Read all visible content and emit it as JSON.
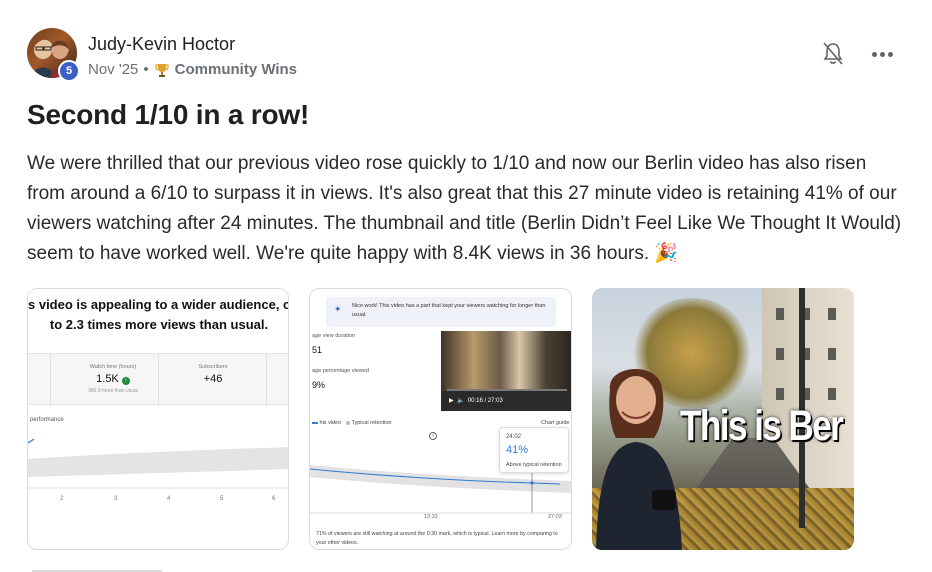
{
  "post": {
    "author": "Judy-Kevin Hoctor",
    "level": "5",
    "date": "Nov '25",
    "separator": "•",
    "category": "Community Wins",
    "title": "Second 1/10 in a row!",
    "body": "We were thrilled that our previous video rose quickly to 1/10 and now our Berlin video has also risen from around a 6/10 to surpass it in views. It's also great that this 27 minute video is retaining 41% of our viewers watching after 24 minutes. The thumbnail and title (Berlin Didn’t Feel Like We Thought It Would) seem to have worked well. We're quite happy with 8.4K views in 36 hours. 🎉"
  },
  "icons": {
    "trophy": "trophy-icon",
    "bell": "bell-off-icon",
    "more": "more-horizontal-icon"
  },
  "colors": {
    "badge": "#3b5fc4",
    "accent_blue": "#2f7dd1"
  },
  "images": [
    {
      "headline_1": "s video is appealing to a wider audience, con",
      "headline_2": "to 2.3 times more views than usual.",
      "stats": [
        {
          "label": "Watch time (hours)",
          "value": "1.5K",
          "sub": "980.9 more than usual"
        },
        {
          "label": "Subscribers",
          "value": "+46",
          "sub": ""
        }
      ],
      "perf_label": "performance",
      "axis": [
        "2",
        "3",
        "4",
        "5",
        "6"
      ]
    },
    {
      "tip": "Nice work! This video has a part that kept your viewers watching for longer than usual.",
      "avd_label": "age view duration",
      "avd_value": "51",
      "apv_label": "age percentage viewed",
      "apv_value": "9%",
      "player_time": "00:16 / 27:03",
      "legend_this": "his video",
      "legend_typical": "Typical retention",
      "legend_guide": "Chart guide",
      "popup_time": "24:02",
      "popup_pct": "41%",
      "popup_note": "Above typical retention",
      "x_mid": "13:32",
      "x_end": "27:03",
      "footnote": "71% of viewers are still watching at around the 0:30 mark, which is typical. Learn more by comparing to your other videos."
    },
    {
      "overlay": "This is Ber"
    }
  ]
}
